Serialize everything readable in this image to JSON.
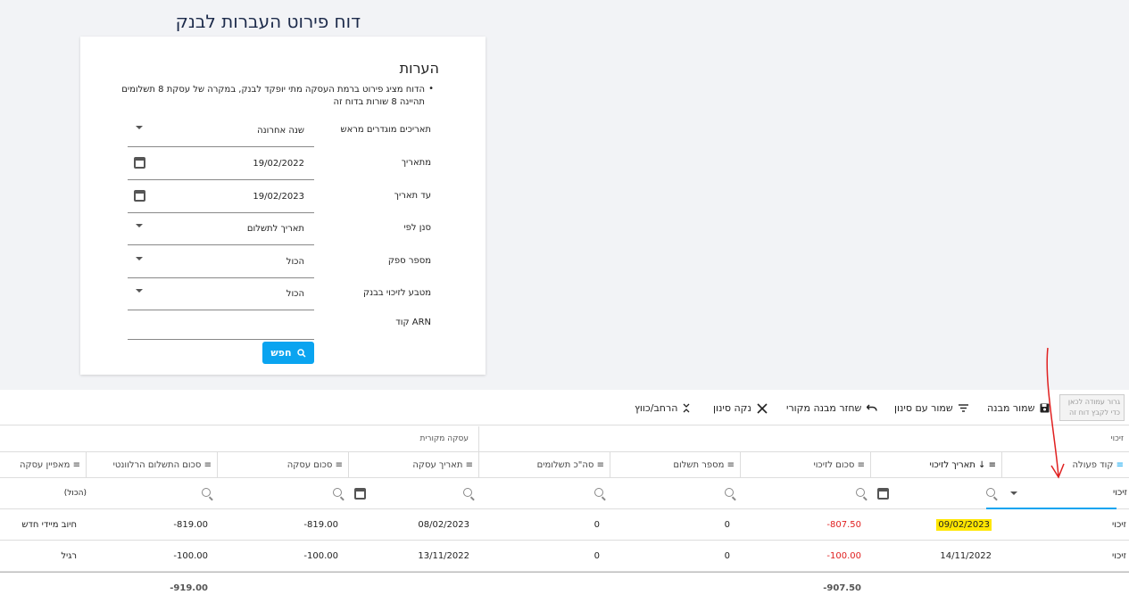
{
  "page": {
    "title": "דוח פירוט העברות לבנק"
  },
  "notes": {
    "title": "הערות",
    "text": "הדוח מציג פירוט ברמת העסקה מתי יופקד לבנק, במקרה של עסקת 8 תשלומים תהיינה 8 שורות בדוח זה"
  },
  "form": {
    "fields": [
      {
        "label": "תאריכים מוגדרים מראש",
        "value": "שנה אחרונה",
        "icon": "chevron-down-icon"
      },
      {
        "label": "מתאריך",
        "value": "19/02/2022",
        "icon": "calendar-icon"
      },
      {
        "label": "עד תאריך",
        "value": "19/02/2023",
        "icon": "calendar-icon"
      },
      {
        "label": "סנן לפי",
        "value": "תאריך לתשלום",
        "icon": "chevron-down-icon"
      },
      {
        "label": "מספר ספק",
        "value": "הכול",
        "icon": "chevron-down-icon"
      },
      {
        "label": "מטבע לזיכוי בבנק",
        "value": "הכול",
        "icon": "chevron-down-icon"
      },
      {
        "label": "קוד ARN",
        "value": "",
        "icon": ""
      }
    ],
    "search_button": "חפש"
  },
  "toolbar": {
    "drop_hint": "גרור עמודה לכאן כדי לקבץ דוח זה",
    "save_layout": "שמור מבנה",
    "save_with_filter": "שמור עם סינון",
    "restore_layout": "שחזר מבנה מקורי",
    "clear_filter": "נקה סינון",
    "expand_collapse": "הרחב/כווץ"
  },
  "grid": {
    "groups": {
      "right": "זיכוי",
      "left": "עסקה מקורית"
    },
    "columns": [
      "קוד פעולה",
      "תאריך לזיכוי ↓",
      "סכום לזיכוי",
      "מספר תשלום",
      "סה\"כ תשלומים",
      "תאריך עסקה",
      "סכום עסקה",
      "סכום התשלום הרלוונטי",
      "מאפיין עסקה"
    ],
    "filter_action_value": "זיכוי",
    "filter_last_value": "(הכול)",
    "rows": [
      [
        "זיכוי",
        "09/02/2023",
        "-807.50",
        "0",
        "0",
        "08/02/2023",
        "-819.00",
        "-819.00",
        "חיוב מיידי חדש"
      ],
      [
        "זיכוי",
        "14/11/2022",
        "-100.00",
        "0",
        "0",
        "13/11/2022",
        "-100.00",
        "-100.00",
        "רגיל"
      ]
    ],
    "totals": {
      "credit_amount": "-907.50",
      "relevant_payment": "-919.00"
    }
  },
  "colors": {
    "accent": "#0aa4f0",
    "negative": "#e02020",
    "highlight": "#ffe600",
    "annotation": "#e02020"
  }
}
